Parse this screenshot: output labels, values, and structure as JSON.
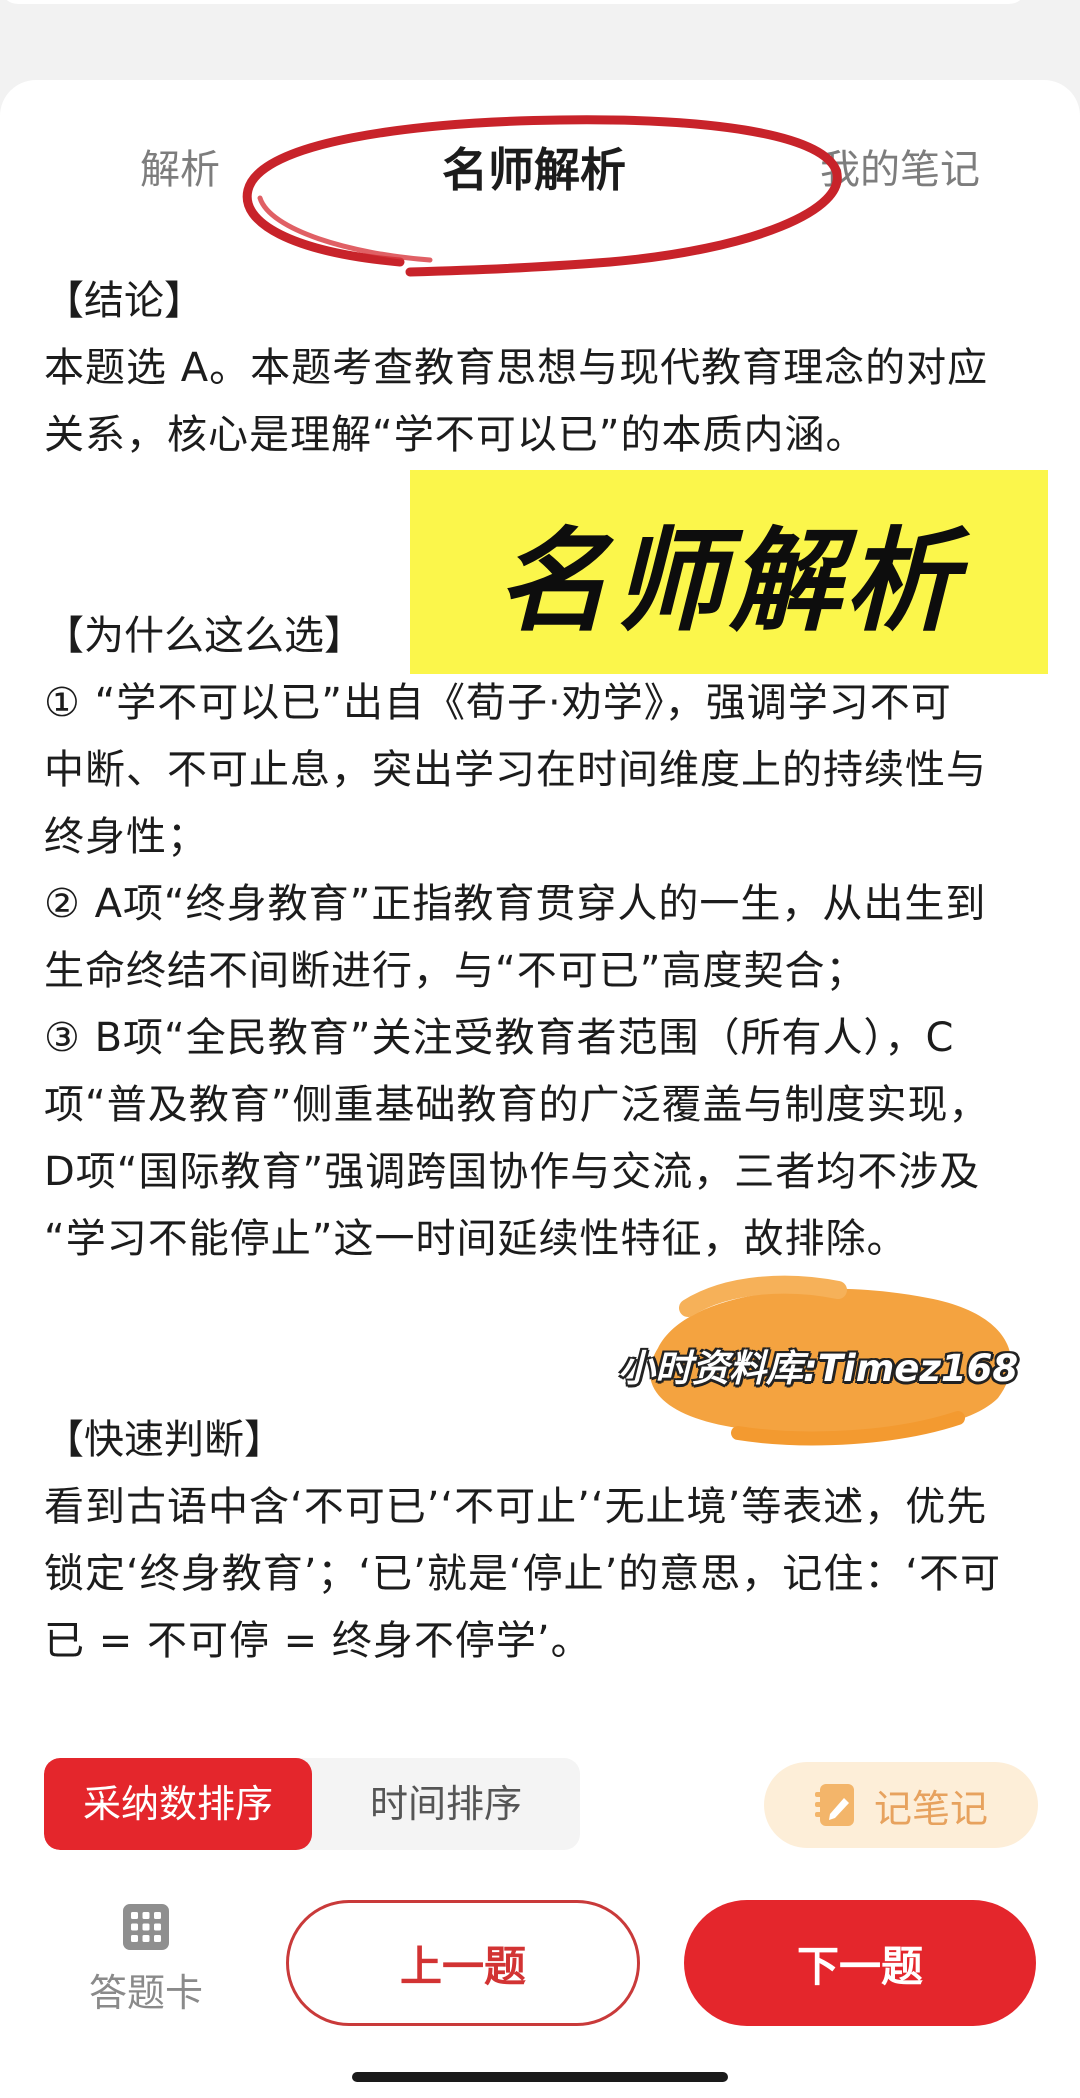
{
  "tabs": [
    {
      "label": "解析"
    },
    {
      "label": "名师解析"
    },
    {
      "label": "我的笔记"
    }
  ],
  "sections": {
    "conclusion": {
      "title": "【结论】",
      "lines": [
        "本题选 A。本题考查教育思想与现代教育理念的对应",
        "关系，核心是理解“学不可以已”的本质内涵。"
      ]
    },
    "reason": {
      "title": "【为什么这么选】",
      "lines": [
        "① “学不可以已”出自《荀子·劝学》，强调学习不可",
        "中断、不可止息，突出学习在时间维度上的持续性与",
        "终身性；",
        "② A项“终身教育”正指教育贯穿人的一生，从出生到",
        "生命终结不间断进行，与“不可已”高度契合；",
        "③ B项“全民教育”关注受教育者范围（所有人），C",
        "项“普及教育”侧重基础教育的广泛覆盖与制度实现，",
        "D项“国际教育”强调跨国协作与交流，三者均不涉及",
        "“学习不能停止”这一时间延续性特征，故排除。"
      ]
    },
    "quick": {
      "title": "【快速判断】",
      "lines": [
        "看到古语中含‘不可已’‘不可止’‘无止境’等表述，优先",
        "锁定‘终身教育’；‘已’就是‘停止’的意思，记住：‘不可",
        "已 = 不可停 = 终身不停学’。"
      ]
    }
  },
  "sticker": {
    "text": "名师解析"
  },
  "watermark": {
    "text": "小时资料库:Timez168"
  },
  "sort": {
    "adopt_label": "采纳数排序",
    "time_label": "时间排序"
  },
  "note_button": {
    "label": "记笔记"
  },
  "bottom": {
    "answer_card_label": "答题卡",
    "prev_label": "上一题",
    "next_label": "下一题"
  },
  "colors": {
    "accent": "#e4262c",
    "sticker": "#fbf64b",
    "note_bg": "#fdeed8",
    "note_fg": "#e7a25e",
    "watermark_blob": "#f4a340"
  }
}
